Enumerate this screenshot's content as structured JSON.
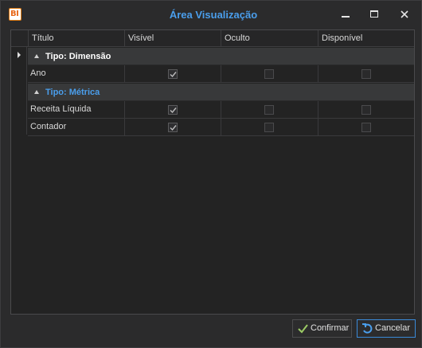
{
  "window": {
    "title": "Área Visualização",
    "app_icon_text": "BI",
    "accent_color": "#4a9eec"
  },
  "grid": {
    "columns": [
      "Título",
      "Visível",
      "Oculto",
      "Disponível"
    ],
    "groups": [
      {
        "label": "Tipo: Dimensão",
        "label_color": "#ffffff",
        "rows": [
          {
            "titulo": "Ano",
            "visivel": true,
            "oculto": false,
            "disponivel": false
          }
        ]
      },
      {
        "label": "Tipo: Métrica",
        "label_color": "#4a9eec",
        "rows": [
          {
            "titulo": "Receita Líquida",
            "visivel": true,
            "oculto": false,
            "disponivel": false
          },
          {
            "titulo": "Contador",
            "visivel": true,
            "oculto": false,
            "disponivel": false
          }
        ]
      }
    ]
  },
  "buttons": {
    "confirm_label": "Confirmar",
    "confirm_icon": "check-icon",
    "cancel_label": "Cancelar",
    "cancel_icon": "undo-icon"
  }
}
